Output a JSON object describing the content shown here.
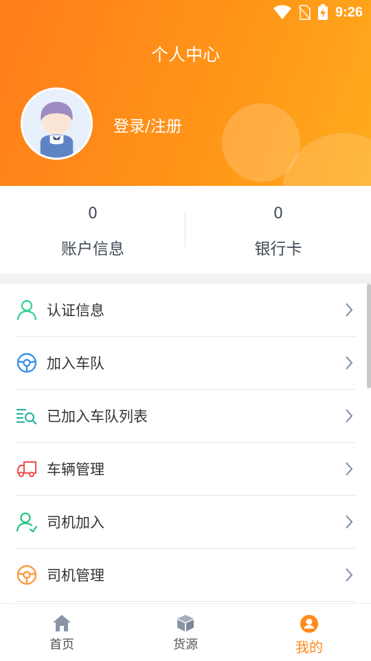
{
  "status_bar": {
    "time": "9:26"
  },
  "header": {
    "title": "个人中心",
    "login_label": "登录/注册"
  },
  "stats": [
    {
      "value": "0",
      "label": "账户信息"
    },
    {
      "value": "0",
      "label": "银行卡"
    }
  ],
  "menu": [
    {
      "label": "认证信息",
      "icon": "user-outline-icon",
      "color": "#2fcf8f"
    },
    {
      "label": "加入车队",
      "icon": "steering-wheel-icon",
      "color": "#3b8fe8"
    },
    {
      "label": "已加入车队列表",
      "icon": "list-search-icon",
      "color": "#28b5a0"
    },
    {
      "label": "车辆管理",
      "icon": "truck-icon",
      "color": "#f04a4a"
    },
    {
      "label": "司机加入",
      "icon": "person-add-icon",
      "color": "#22c27a"
    },
    {
      "label": "司机管理",
      "icon": "steering-wheel-icon",
      "color": "#ff9a3c"
    }
  ],
  "tabs": [
    {
      "label": "首页",
      "icon": "home-icon"
    },
    {
      "label": "货源",
      "icon": "box-icon"
    },
    {
      "label": "我的",
      "icon": "profile-icon",
      "active": true
    }
  ],
  "colors": {
    "accent": "#ff8a1a",
    "header_start": "#ff7d1a",
    "header_end": "#ffab1c",
    "tab_inactive": "#8a95a8"
  }
}
